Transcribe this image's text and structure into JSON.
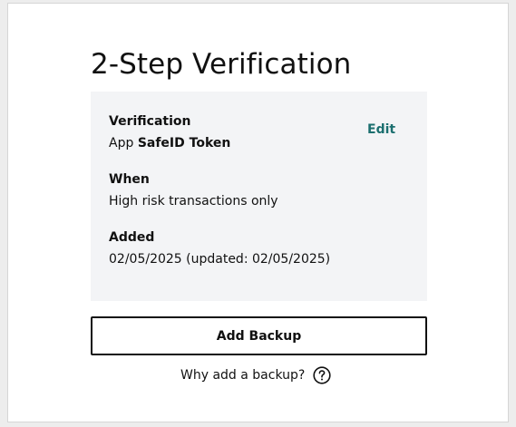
{
  "page": {
    "title": "2-Step Verification"
  },
  "details": {
    "verification_label": "Verification",
    "verification_value_prefix": "App",
    "verification_value_name": "SafeID Token",
    "edit_label": "Edit",
    "when_label": "When",
    "when_value": "High risk transactions only",
    "added_label": "Added",
    "added_value": "02/05/2025 (updated: 02/05/2025)"
  },
  "actions": {
    "add_backup_label": "Add Backup",
    "why_backup_label": "Why add a backup?",
    "help_icon": "question-circle-icon"
  },
  "colors": {
    "accent_link": "#1b6f6f",
    "panel_background": "#f3f4f6",
    "page_background": "#ededed"
  }
}
